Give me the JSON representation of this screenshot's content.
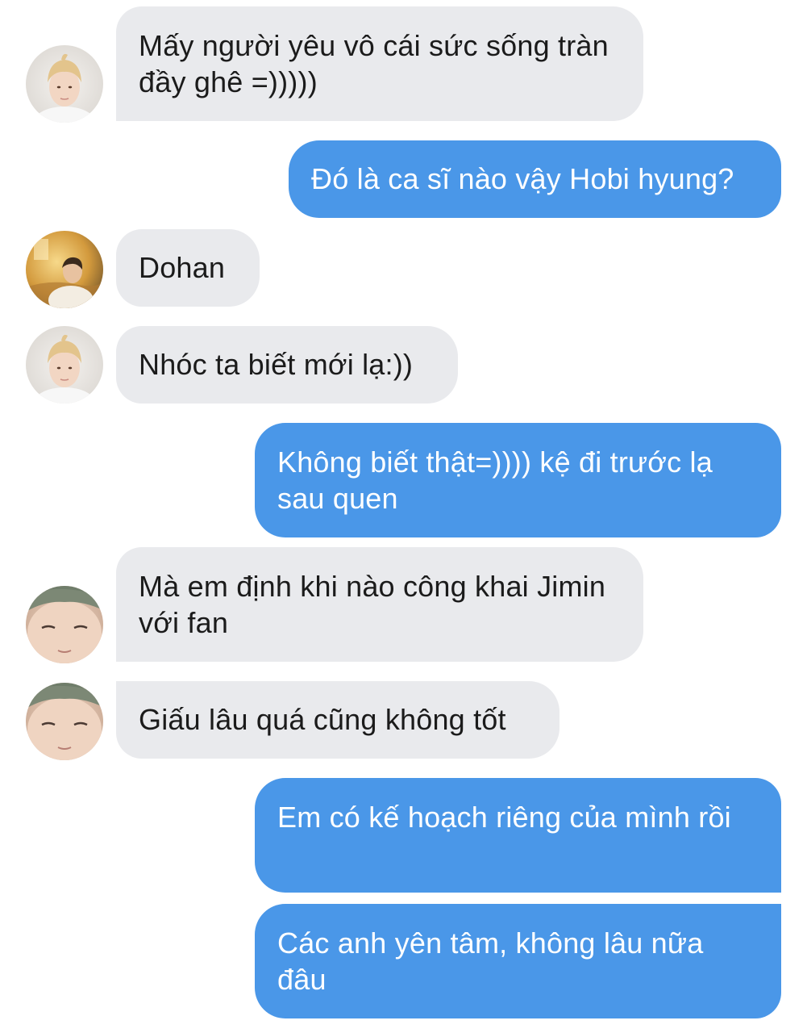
{
  "conversation": {
    "messages": [
      {
        "sender": "hobi",
        "direction": "in",
        "text": "Mấy người yêu vô cái sức sống tràn đầy ghê =)))))"
      },
      {
        "sender": "me",
        "direction": "out",
        "text": "Đó là ca sĩ nào vậy Hobi hyung?"
      },
      {
        "sender": "dohan-user",
        "direction": "in",
        "text": "Dohan"
      },
      {
        "sender": "hobi",
        "direction": "in",
        "text": "Nhóc ta biết mới lạ:))"
      },
      {
        "sender": "me",
        "direction": "out",
        "text": "Không biết thật=)))) kệ đi trước lạ sau quen"
      },
      {
        "sender": "namjoon",
        "direction": "in",
        "text": "Mà em định khi nào công khai Jimin với fan"
      },
      {
        "sender": "namjoon",
        "direction": "in",
        "text": "Giấu lâu quá cũng không tốt"
      },
      {
        "sender": "me",
        "direction": "out",
        "text": "Em có kế hoạch riêng của mình rồi"
      },
      {
        "sender": "me",
        "direction": "out",
        "text": "Các anh yên tâm, không lâu nữa đâu"
      }
    ]
  },
  "colors": {
    "incoming_bubble": "#e9eaed",
    "outgoing_bubble": "#4a97e8",
    "incoming_text": "#1b1b1b",
    "outgoing_text": "#ffffff",
    "background": "#ffffff"
  },
  "icons": {
    "avatar_hobi": "blond-hair-person-avatar-icon",
    "avatar_dohan": "golden-light-person-avatar-icon",
    "avatar_namjoon": "smiling-face-closeup-avatar-icon"
  }
}
